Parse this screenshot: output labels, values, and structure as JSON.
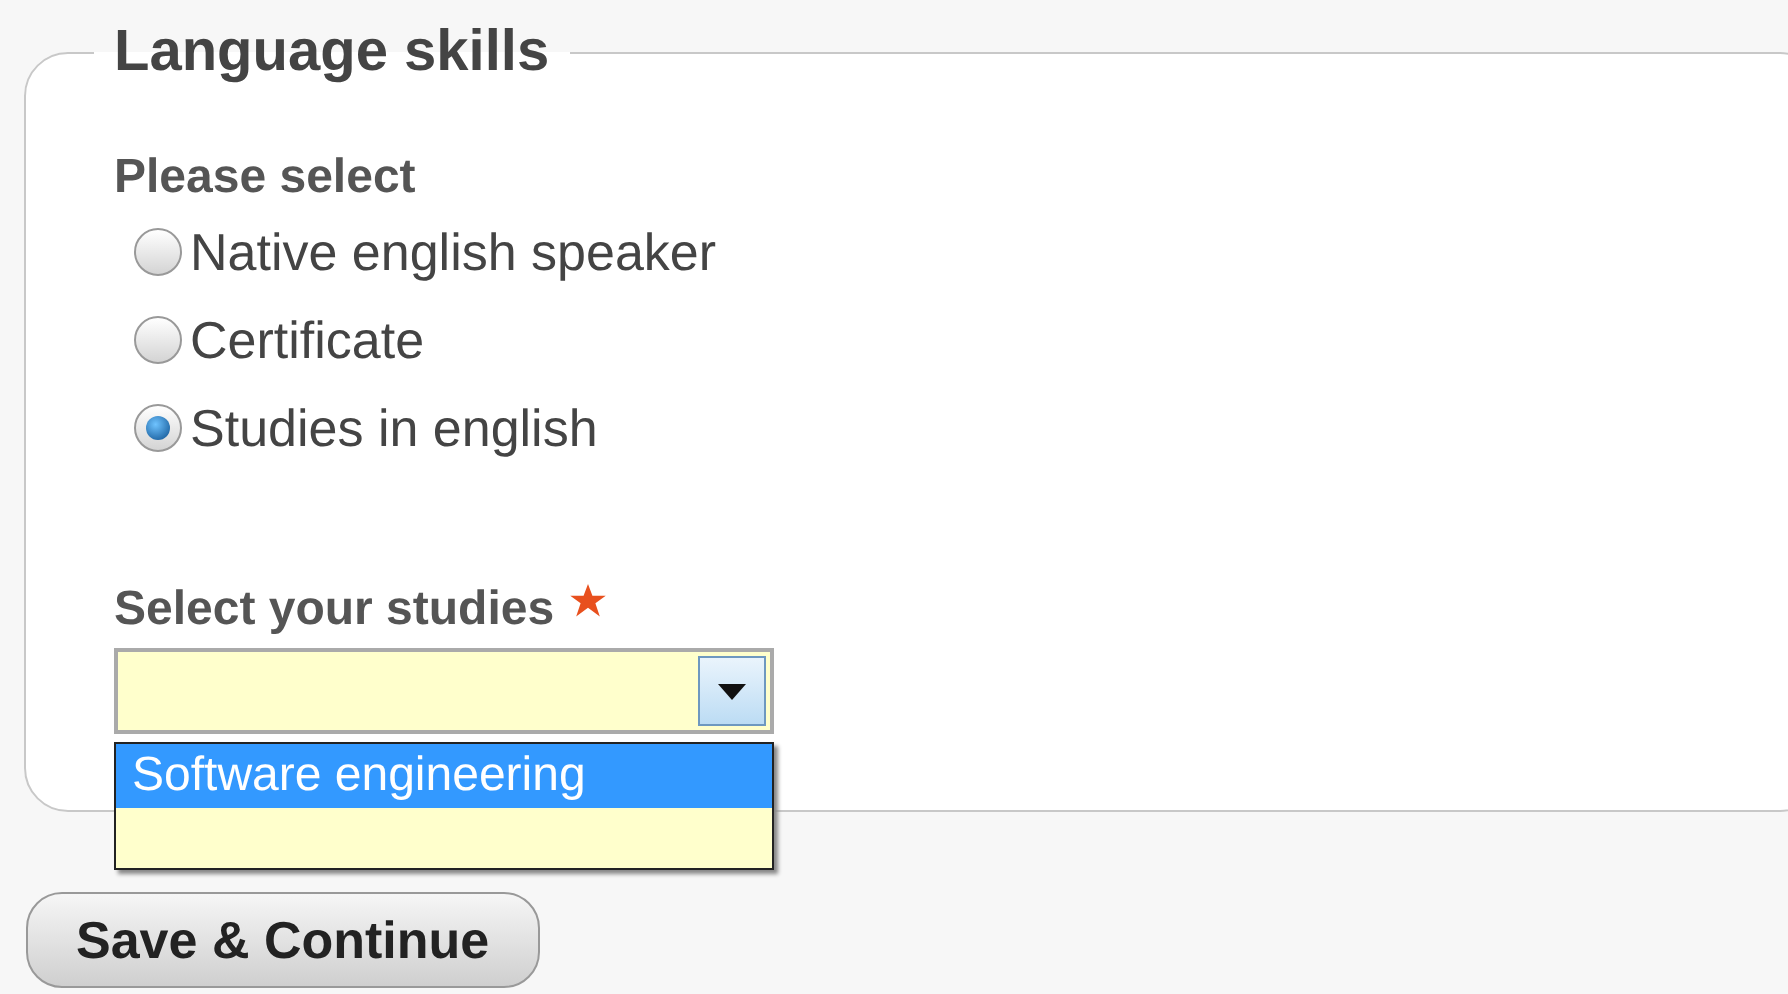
{
  "fieldset": {
    "legend": "Language skills"
  },
  "question": {
    "label": "Please select",
    "options": [
      {
        "label": "Native english speaker",
        "selected": false
      },
      {
        "label": "Certificate",
        "selected": false
      },
      {
        "label": "Studies in english",
        "selected": true
      }
    ]
  },
  "studies": {
    "label": "Select your studies",
    "required": true,
    "expanded": true,
    "options": [
      {
        "label": "Software engineering",
        "selected": true
      }
    ]
  },
  "buttons": [
    {
      "label": "Save & Continue"
    }
  ]
}
